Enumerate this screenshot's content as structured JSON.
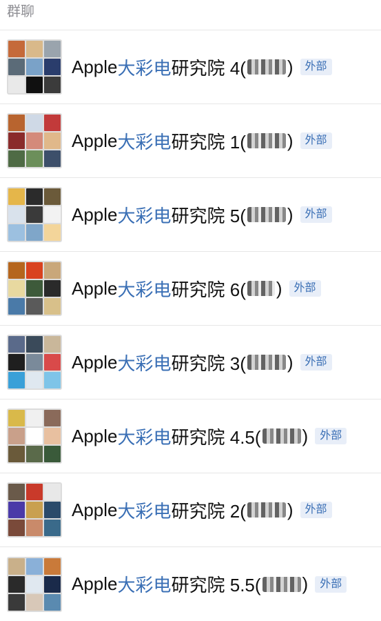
{
  "section": {
    "title": "群聊"
  },
  "groups": [
    {
      "prefix": "Apple",
      "highlight": "大彩电",
      "suffix": "研究院 4(",
      "close": ")",
      "badge": "外部",
      "tiles": [
        "#c56a3a",
        "#d9b98a",
        "#9aa4ad",
        "#5b6b78",
        "#7aa2c8",
        "#2a3d6c",
        "#e9e9e9",
        "#101010",
        "#3b3b3b"
      ]
    },
    {
      "prefix": "Apple",
      "highlight": "大彩电",
      "suffix": "研究院 1(",
      "close": ")",
      "badge": "外部",
      "tiles": [
        "#b8642f",
        "#cfd9e6",
        "#c23a3a",
        "#8a2b2b",
        "#d48a7a",
        "#e0b88a",
        "#4f6b45",
        "#6c8f5a",
        "#3d4f6a"
      ]
    },
    {
      "prefix": "Apple",
      "highlight": "大彩电",
      "suffix": "研究院 5(",
      "close": ")",
      "badge": "外部",
      "tiles": [
        "#e5b64a",
        "#2b2b2b",
        "#6b5a3a",
        "#d9e2ec",
        "#3a3a3a",
        "#f2f2f2",
        "#9cc0e0",
        "#7fa6c9",
        "#f3d59a"
      ]
    },
    {
      "prefix": "Apple",
      "highlight": "大彩电",
      "suffix": "研究院 6(",
      "close": ")",
      "badge": "外部",
      "tiles": [
        "#b5651d",
        "#d9421f",
        "#c9a77a",
        "#e8d9a0",
        "#3d5a3a",
        "#2a2a2a",
        "#4a7aa8",
        "#5a5a5a",
        "#d8c08a"
      ]
    },
    {
      "prefix": "Apple",
      "highlight": "大彩电",
      "suffix": "研究院 3(",
      "close": ")",
      "badge": "外部",
      "tiles": [
        "#5a6a8a",
        "#3a4a5a",
        "#c9b79a",
        "#1f1f1f",
        "#7a8a9a",
        "#d94a4a",
        "#3aa0d8",
        "#dfe8f0",
        "#7ec4e8"
      ]
    },
    {
      "prefix": "Apple",
      "highlight": "大彩电",
      "suffix": "研究院 4.5(",
      "close": ")",
      "badge": "外部",
      "tiles": [
        "#d9b94a",
        "#f0f0f0",
        "#8a6a5a",
        "#c9a08a",
        "#ffffff",
        "#e8c0a0",
        "#6a5a3a",
        "#5a6a4a",
        "#3a5a3a"
      ]
    },
    {
      "prefix": "Apple",
      "highlight": "大彩电",
      "suffix": "研究院 2(",
      "close": ")",
      "badge": "外部",
      "tiles": [
        "#6a5a4a",
        "#c93a2a",
        "#e8e8e8",
        "#4a3aa8",
        "#c9a050",
        "#2a4a6a",
        "#7a4a3a",
        "#c98a6a",
        "#3a6a8a"
      ]
    },
    {
      "prefix": "Apple",
      "highlight": "大彩电",
      "suffix": "研究院 5.5(",
      "close": ")",
      "badge": "外部",
      "tiles": [
        "#c9b08a",
        "#8ab0d8",
        "#c97a3a",
        "#2a2a2a",
        "#e0e8f0",
        "#1a2a4a",
        "#3a3a3a",
        "#d8c8b8",
        "#5a8ab0"
      ]
    }
  ]
}
